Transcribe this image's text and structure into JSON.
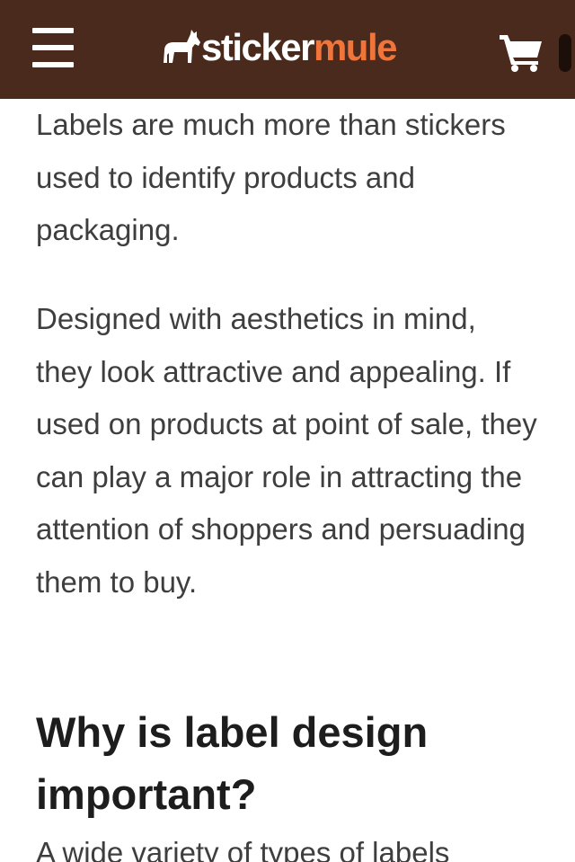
{
  "header": {
    "logo_sticker": "sticker",
    "logo_mule": "mule",
    "colors": {
      "background": "#4a2a1c",
      "accent": "#f0753a"
    },
    "icons": {
      "menu": "hamburger-menu-icon",
      "logo": "mule-icon",
      "cart": "shopping-cart-icon"
    }
  },
  "article": {
    "paragraph_1": "Labels are much more than stickers used to identify products and packaging.",
    "paragraph_2": "Designed with aesthetics in mind, they look attractive and appealing. If used on products at point of sale, they can play a major role in attracting the attention of shoppers and persuading them to buy.",
    "heading": "Why is label design important?",
    "paragraph_3": "A wide variety of types of labels"
  }
}
